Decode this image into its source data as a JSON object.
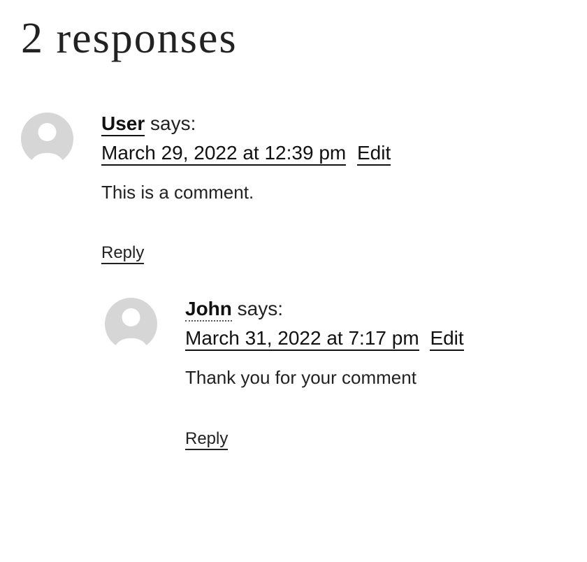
{
  "section_title": "2 responses",
  "says_label": "says:",
  "edit_label": "Edit",
  "reply_label": "Reply",
  "comments": [
    {
      "author": "User",
      "author_style": "solid",
      "date": "March 29, 2022 at 12:39 pm",
      "content": "This is a comment.",
      "nested": false
    },
    {
      "author": "John",
      "author_style": "dotted",
      "date": "March 31, 2022 at 7:17 pm",
      "content": "Thank you for your comment",
      "nested": true
    }
  ]
}
